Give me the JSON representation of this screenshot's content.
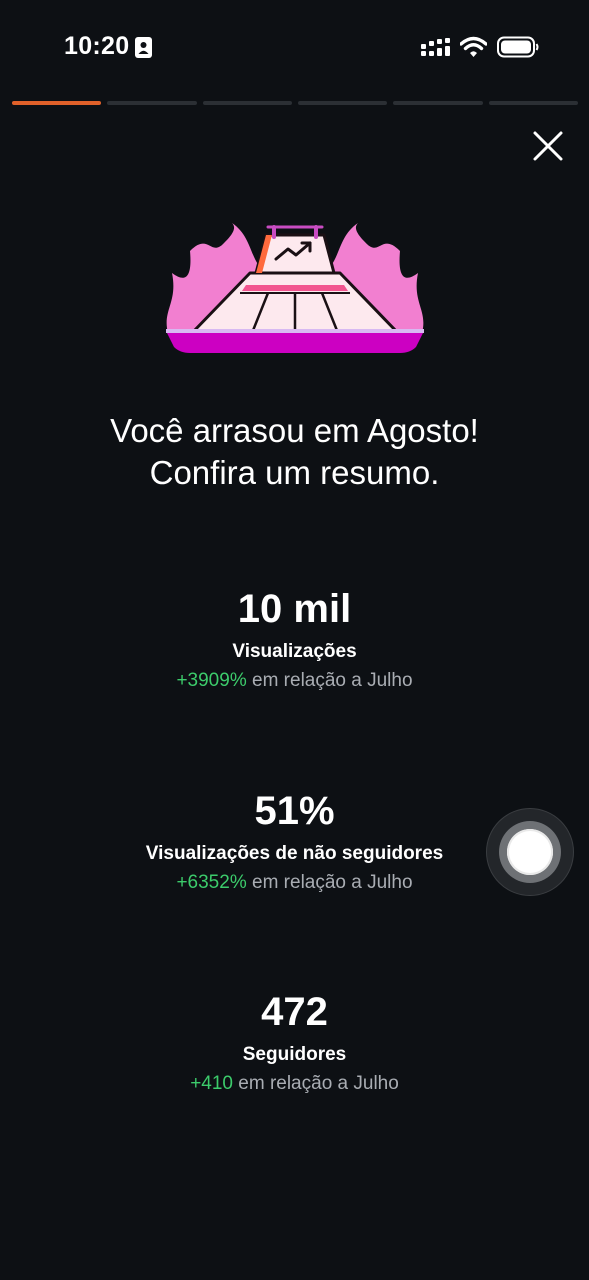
{
  "status_bar": {
    "time": "10:20"
  },
  "story": {
    "segments": 6,
    "active_segment": 1
  },
  "headline": {
    "line1": "Você arrasou em Agosto!",
    "line2": "Confira um resumo."
  },
  "stats": [
    {
      "value": "10 mil",
      "label": "Visualizações",
      "delta": "+3909%",
      "comparison": "em relação a Julho"
    },
    {
      "value": "51%",
      "label": "Visualizações de não seguidores",
      "delta": "+6352%",
      "comparison": "em relação a Julho"
    },
    {
      "value": "472",
      "label": "Seguidores",
      "delta": "+410",
      "comparison": "em relação a Julho"
    }
  ],
  "colors": {
    "background": "#0d1014",
    "progress_active": "#e0612a",
    "delta_positive": "#3ccb6b",
    "flame": "#f27fd0",
    "base": "#cc00c2"
  },
  "icons": [
    "id-card-icon",
    "cellular-signal-icon",
    "wifi-icon",
    "battery-icon",
    "close-icon",
    "trending-up-icon"
  ]
}
